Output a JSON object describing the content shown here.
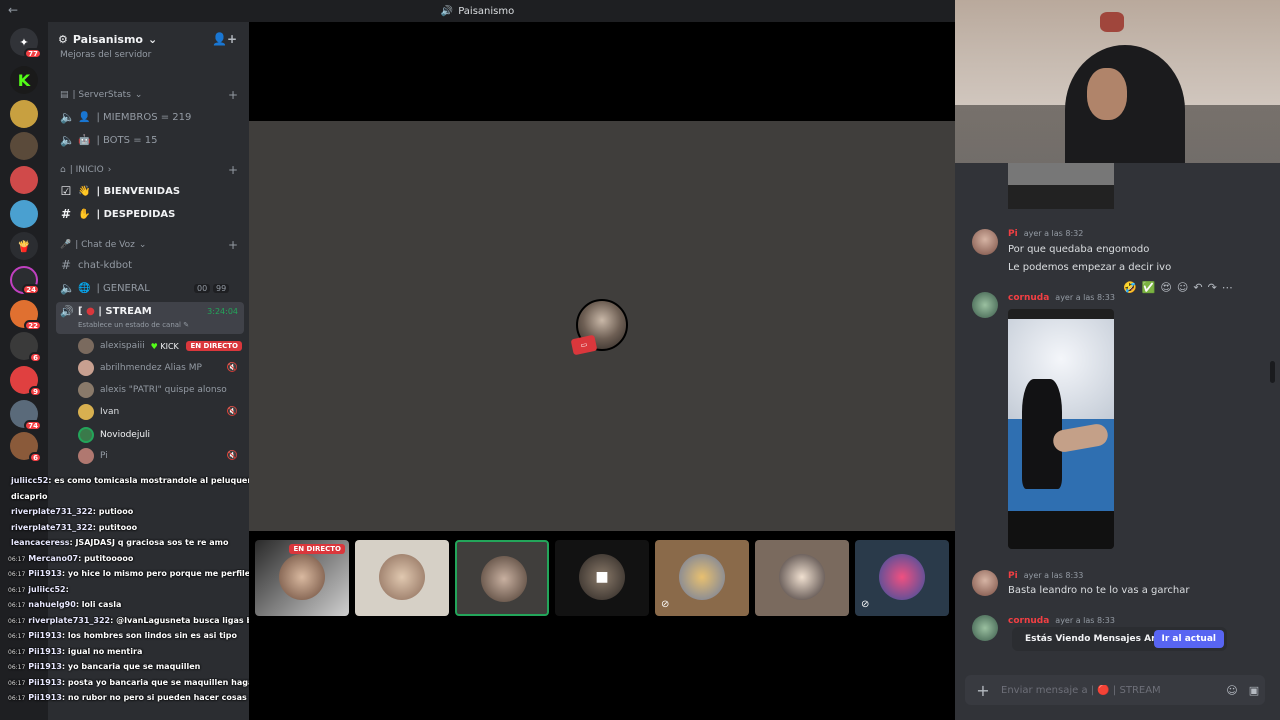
{
  "window": {
    "title": "Paisanismo"
  },
  "rail": {
    "badges": [
      "77",
      "24",
      "22",
      "6",
      "9",
      "74",
      "6"
    ]
  },
  "guild": {
    "name": "Paisanismo",
    "boost_text": "Mejoras del servidor"
  },
  "categories": {
    "serverstats": "| ServerStats",
    "inicio": "| INICIO",
    "voz": "| Chat de Voz"
  },
  "channels": {
    "miembros": "| MIEMBROS = 219",
    "bots": "| BOTS = 15",
    "bienvenidas": "| BIENVENIDAS",
    "despedidas": "| DESPEDIDAS",
    "chatkdbot": "chat-kdbot",
    "general": "| GENERAL",
    "general_count_a": "00",
    "general_count_b": "99",
    "stream": "| STREAM",
    "stream_timer": "3:24:04",
    "stream_status": "Establece un estado de canal"
  },
  "voice_users": [
    {
      "name": "alexispaiii",
      "tag": "KICK",
      "badge": "EN DIRECTO"
    },
    {
      "name": "abrilhmendez Alias MP"
    },
    {
      "name": "alexis \"PATRI\" quispe alonso"
    },
    {
      "name": "Ivan"
    },
    {
      "name": "Noviodejuli"
    },
    {
      "name": "Pi"
    }
  ],
  "chat_overlay": [
    {
      "time": "",
      "user": "juliicc52",
      "text": ": es como tomicasla mostrandole al peluquero una foto de"
    },
    {
      "time": "",
      "user": "",
      "text": "dicaprio"
    },
    {
      "time": "",
      "user": "riverplate731_322",
      "text": ": putiooo"
    },
    {
      "time": "",
      "user": "riverplate731_322",
      "text": ": putitooo"
    },
    {
      "time": "",
      "user": "leancaceress",
      "text": ": JSAJDASJ q graciosa sos te re amo"
    },
    {
      "time": "06:17",
      "user": "Mercano07",
      "text": ": putitooooo"
    },
    {
      "time": "06:17",
      "user": "Pii1913",
      "text": ": yo hice lo mismo pero porque me perfile mal y bueno"
    },
    {
      "time": "06:17",
      "user": "juliicc52",
      "text": ":"
    },
    {
      "time": "06:17",
      "user": "nahuelg90",
      "text": ": loli casla"
    },
    {
      "time": "06:17",
      "user": "riverplate731_322",
      "text": ": @IvanLagusneta busca ligas bro aura"
    },
    {
      "time": "06:17",
      "user": "Pii1913",
      "text": ": los hombres son lindos sin       es asi tipo"
    },
    {
      "time": "06:17",
      "user": "Pii1913",
      "text": ": igual no mentira"
    },
    {
      "time": "06:17",
      "user": "Pii1913",
      "text": ": yo bancaria que se maquillen"
    },
    {
      "time": "06:17",
      "user": "Pii1913",
      "text": ": posta yo bancaria que se maquillen haganlo"
    },
    {
      "time": "06:17",
      "user": "Pii1913",
      "text": ": no rubor no pero si pueden hacer cosas"
    }
  ],
  "tiles": [
    {
      "label": "EN DIRECTO"
    }
  ],
  "messages": [
    {
      "author": "Pi",
      "time": "ayer a las 8:32",
      "lines": [
        "Por que quedaba engomodo",
        "Le podemos empezar a decir ivo"
      ]
    },
    {
      "author": "cornuda",
      "time": "ayer a las 8:33"
    },
    {
      "author": "Pi",
      "time": "ayer a las 8:33",
      "lines": [
        "Basta leandro no te lo vas a garchar"
      ]
    },
    {
      "author": "cornuda",
      "time": "ayer a las 8:33"
    }
  ],
  "jump": {
    "text": "Estás Viendo Mensajes Antiguos",
    "button": "Ir al actual"
  },
  "composer": {
    "placeholder": "Enviar mensaje a | 🔴 | STREAM"
  },
  "colors": {
    "accent": "#5865f2",
    "live": "#da373c",
    "online": "#23a55a",
    "name_red": "#f23f43"
  }
}
